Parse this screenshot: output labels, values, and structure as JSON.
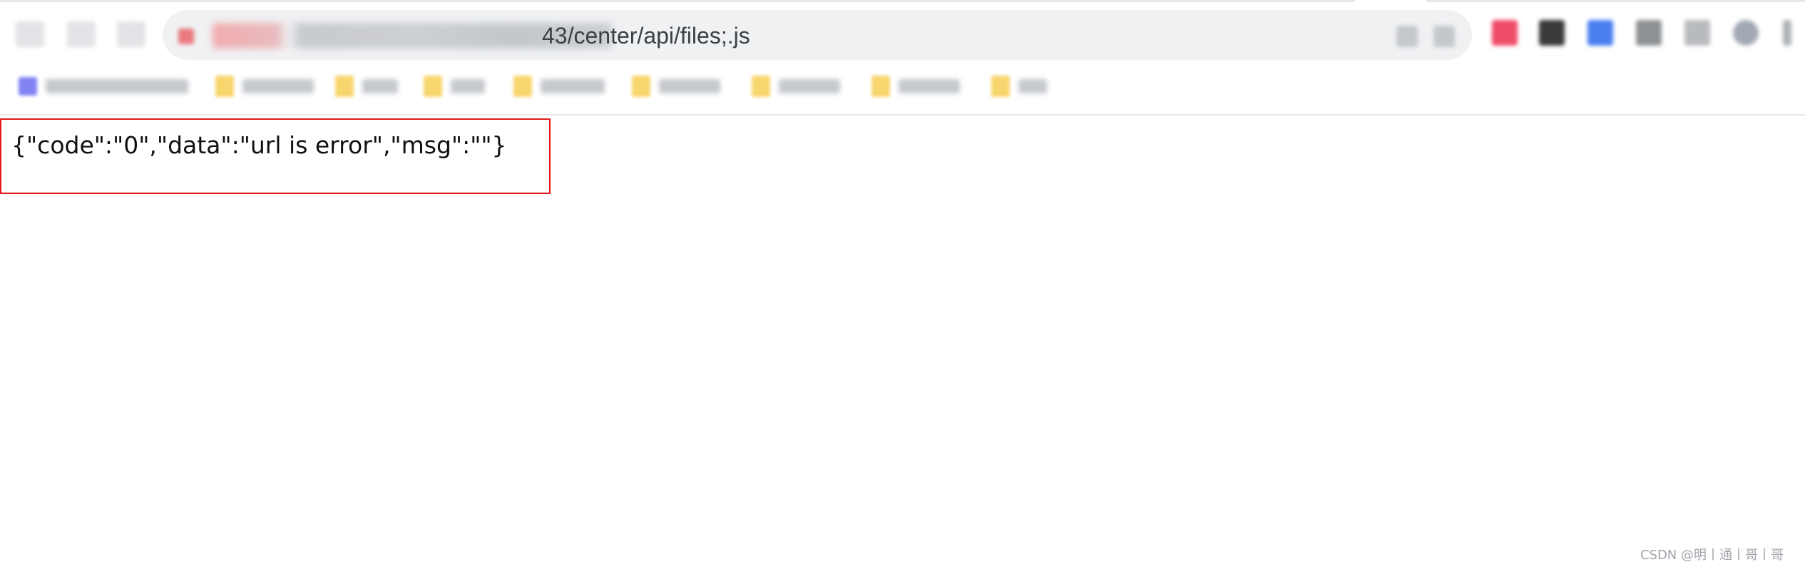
{
  "browser": {
    "address_bar": {
      "visible_url_path": "43/center/api/files;.js"
    }
  },
  "content": {
    "response_text": "{\"code\":\"0\",\"data\":\"url is error\",\"msg\":\"\"}"
  },
  "watermark": {
    "text": "CSDN @明丨通丨哥丨哥"
  },
  "colors": {
    "highlight_border": "#e31b1b",
    "omnibox_bg": "#f0f1f3",
    "text": "#111111"
  },
  "icons": [
    "back-icon",
    "forward-icon",
    "reload-icon",
    "lock-icon",
    "folder-icon",
    "bookmark-favicon",
    "extension-icon"
  ]
}
